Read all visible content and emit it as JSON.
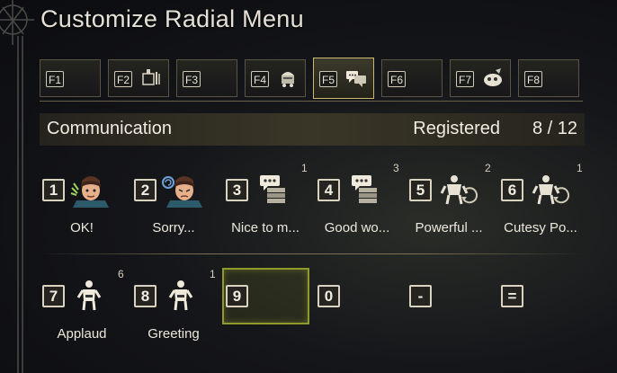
{
  "title": "Customize Radial Menu",
  "tabs": [
    {
      "key": "F1",
      "icon": ""
    },
    {
      "key": "F2",
      "icon": "item-icon"
    },
    {
      "key": "F3",
      "icon": ""
    },
    {
      "key": "F4",
      "icon": "station-icon"
    },
    {
      "key": "F5",
      "icon": "chat-icon",
      "active": true
    },
    {
      "key": "F6",
      "icon": ""
    },
    {
      "key": "F7",
      "icon": "sticker-icon"
    },
    {
      "key": "F8",
      "icon": ""
    }
  ],
  "header": {
    "category": "Communication",
    "registered_label": "Registered",
    "registered_count": "8 / 12"
  },
  "slots": [
    {
      "key": "1",
      "icon": "hunter-ok-icon",
      "label": "OK!",
      "count": ""
    },
    {
      "key": "2",
      "icon": "hunter-sorry-icon",
      "label": "Sorry...",
      "count": ""
    },
    {
      "key": "3",
      "icon": "chat-bubble-icon",
      "label": "Nice to m...",
      "count": "1"
    },
    {
      "key": "4",
      "icon": "chat-bubble-icon",
      "label": "Good wo...",
      "count": "3"
    },
    {
      "key": "5",
      "icon": "pose-icon",
      "label": "Powerful ...",
      "count": "2"
    },
    {
      "key": "6",
      "icon": "pose-icon",
      "label": "Cutesy Po...",
      "count": "1"
    },
    {
      "key": "7",
      "icon": "gesture-figure-icon",
      "label": "Applaud",
      "count": "6"
    },
    {
      "key": "8",
      "icon": "gesture-figure-icon",
      "label": "Greeting",
      "count": "1"
    },
    {
      "key": "9",
      "icon": "",
      "label": "",
      "count": ""
    },
    {
      "key": "0",
      "icon": "",
      "label": "",
      "count": ""
    },
    {
      "key": "-",
      "icon": "",
      "label": "",
      "count": ""
    },
    {
      "key": "=",
      "icon": "",
      "label": "",
      "count": ""
    }
  ]
}
